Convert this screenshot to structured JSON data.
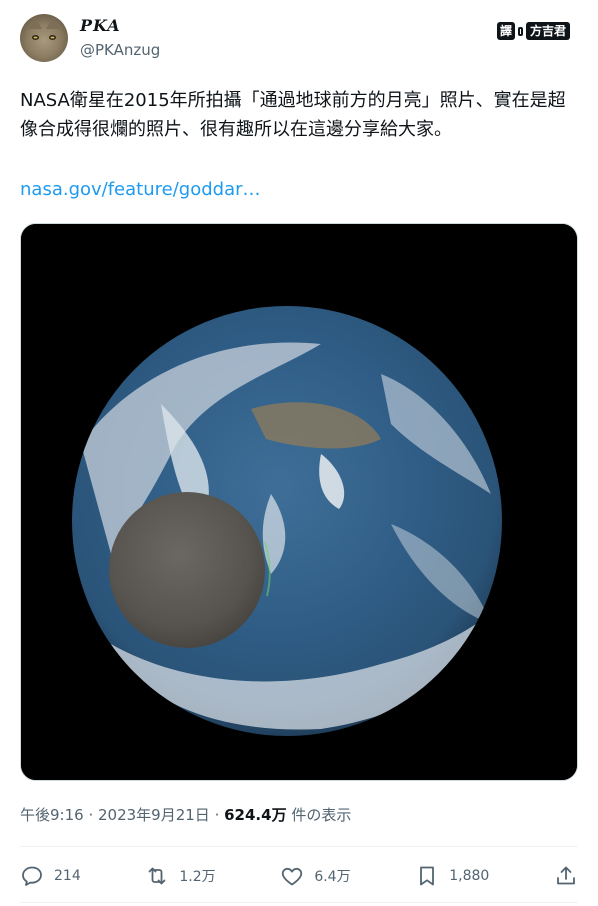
{
  "author": {
    "name": "PKA",
    "handle": "@PKAnzug"
  },
  "translate_badge": {
    "left": "譯",
    "right": "方吉君"
  },
  "tweet": {
    "text": "NASA衛星在2015年所拍攝「通過地球前方的月亮」照片、實在是超像合成得很爛的照片、很有趣所以在這邊分享給大家。",
    "link": "nasa.gov/feature/goddar…"
  },
  "meta": {
    "time": "午後9:16",
    "dot1": " · ",
    "date": "2023年9月21日",
    "dot2": " · ",
    "views": "624.4万",
    "views_suffix": " 件の表示"
  },
  "actions": {
    "replies": "214",
    "reposts": "1.2万",
    "likes": "6.4万",
    "bookmarks": "1,880"
  },
  "icons": [
    "reply-icon",
    "repost-icon",
    "like-icon",
    "bookmark-icon",
    "share-icon"
  ],
  "colors": {
    "link": "#1d9bf0",
    "secondary_text": "#536471",
    "primary_text": "#0f1419"
  }
}
